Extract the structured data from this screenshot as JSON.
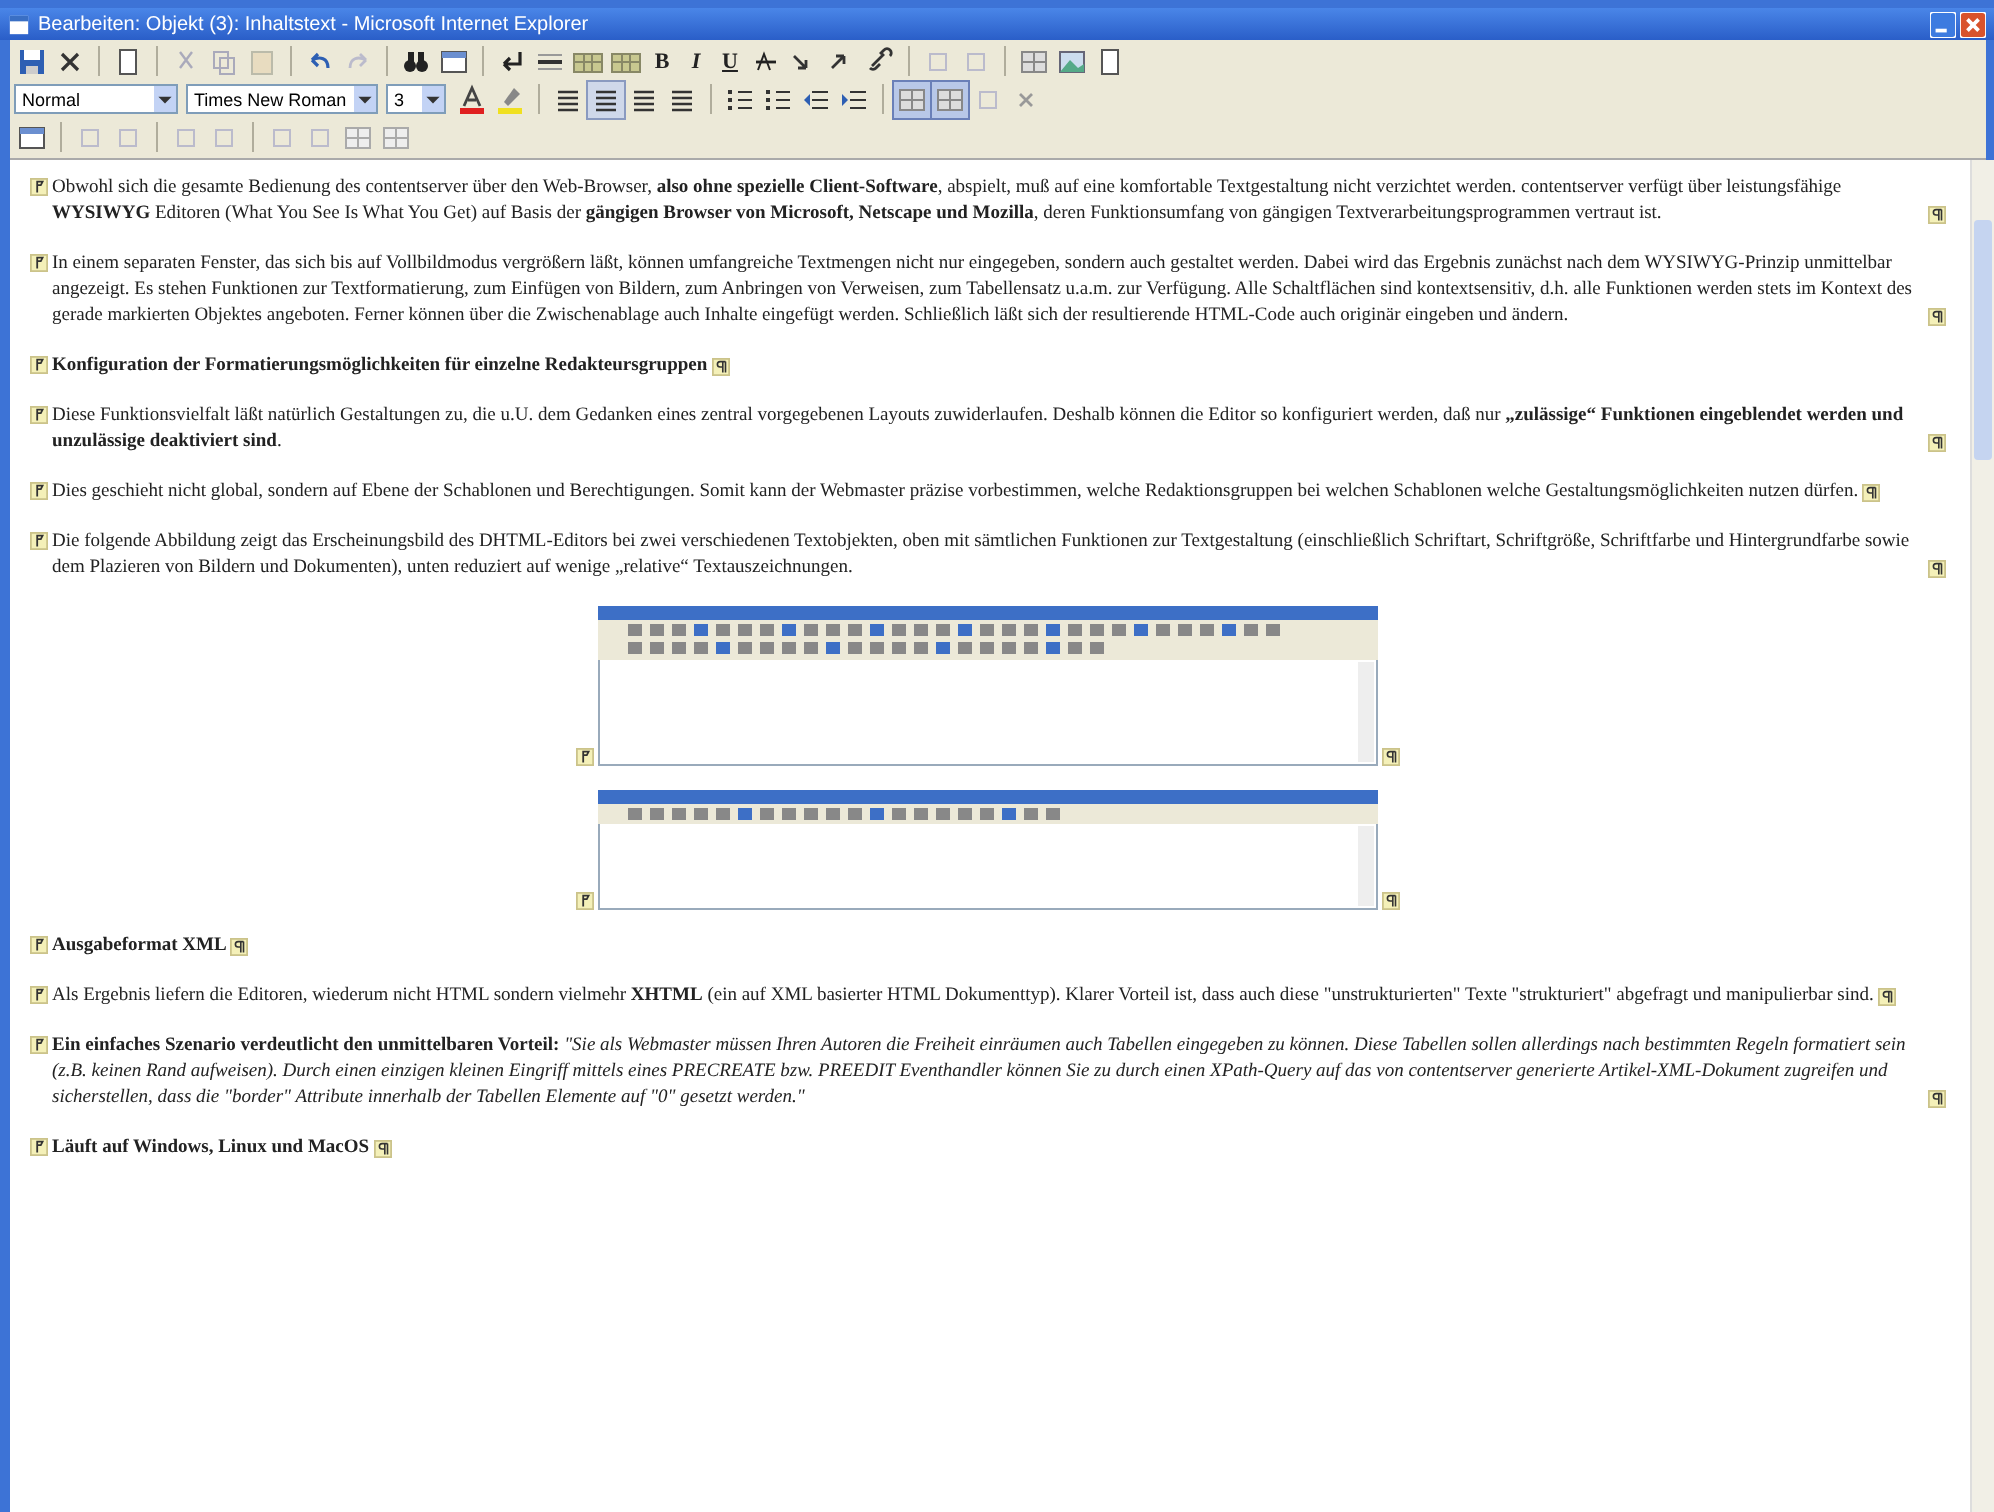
{
  "window": {
    "title": "Bearbeiten: Objekt (3): Inhaltstext - Microsoft Internet Explorer"
  },
  "toolbar": {
    "format_buttons": [
      "B",
      "I",
      "U"
    ],
    "style_select": "Normal",
    "font_select": "Times New Roman",
    "size_select": "3",
    "align_buttons": [
      {
        "selected": false
      },
      {
        "selected": true
      },
      {
        "selected": false
      },
      {
        "selected": false
      }
    ]
  },
  "blocks": [
    {
      "kind": "paragraph",
      "text": "Obwohl sich die gesamte Bedienung des contentserver über den Web-Browser, **also ohne spezielle Client-Software**, abspielt, muß auf eine komfortable Textgestaltung nicht verzichtet werden. contentserver verfügt über leistungsfähige **WYSIWYG** Editoren (What You See Is What You Get) auf Basis der **gängigen Browser von Microsoft, Netscape und Mozilla**, deren Funktionsumfang von gängigen Textverarbeitungsprogrammen vertraut ist."
    },
    {
      "kind": "paragraph",
      "text": "In einem separaten Fenster, das sich bis auf Vollbildmodus vergrößern läßt, können umfangreiche Textmengen nicht nur eingegeben, sondern auch gestaltet werden. Dabei wird das Ergebnis zunächst nach dem WYSIWYG-Prinzip unmittelbar angezeigt. Es stehen Funktionen zur Textformatierung, zum Einfügen von Bildern, zum Anbringen von Verweisen, zum Tabellensatz u.a.m. zur Verfügung. Alle Schaltflächen sind kontextsensitiv, d.h. alle Funktionen werden stets im Kontext des gerade markierten Objektes angeboten. Ferner können über die Zwischenablage auch Inhalte eingefügt werden. Schließlich läßt sich der resultierende HTML-Code auch originär eingeben und ändern."
    },
    {
      "kind": "heading",
      "text": "Konfiguration der Formatierungsmöglichkeiten für einzelne Redakteursgruppen"
    },
    {
      "kind": "paragraph",
      "text": "Diese Funktionsvielfalt läßt natürlich Gestaltungen zu, die u.U. dem Gedanken eines zentral vorgegebenen Layouts zuwiderlaufen. Deshalb können die Editor so konfiguriert werden, daß nur **„zulässige“ Funktionen eingeblendet werden und unzulässige deaktiviert sind**."
    },
    {
      "kind": "paragraph",
      "text": "Dies geschieht nicht global, sondern auf Ebene der Schablonen und Berechtigungen. Somit kann der Webmaster präzise vorbestimmen, welche Redaktionsgruppen bei welchen Schablonen welche Gestaltungsmöglichkeiten nutzen dürfen."
    },
    {
      "kind": "paragraph",
      "text": "Die folgende Abbildung zeigt das Erscheinungsbild des DHTML-Editors bei zwei verschiedenen Textobjekten, oben mit sämtlichen Funktionen zur Textgestaltung (einschließlich Schriftart, Schriftgröße, Schriftfarbe und Hintergrundfarbe sowie dem Plazieren von Bildern und Dokumenten), unten reduziert auf wenige „relative“ Textauszeichnungen."
    },
    {
      "kind": "figure",
      "reduced": false
    },
    {
      "kind": "figure",
      "reduced": true
    },
    {
      "kind": "heading",
      "text": "Ausgabeformat XML"
    },
    {
      "kind": "paragraph",
      "text": "Als Ergebnis liefern die Editoren, wiederum nicht HTML sondern vielmehr **XHTML** (ein auf XML basierter HTML Dokumenttyp). Klarer Vorteil ist, dass auch diese \"unstrukturierten\" Texte \"strukturiert\" abgefragt und manipulierbar sind."
    },
    {
      "kind": "paragraph",
      "text": "**Ein einfaches Szenario verdeutlicht den unmittelbaren Vorteil:** *\"Sie als Webmaster müssen Ihren Autoren die Freiheit einräumen auch Tabellen eingegeben zu können. Diese Tabellen sollen allerdings nach bestimmten Regeln formatiert sein (z.B. keinen Rand aufweisen). Durch einen einzigen kleinen Eingriff mittels eines PRECREATE bzw. PREEDIT Eventhandler können Sie zu durch einen XPath-Query auf das von contentserver generierte Artikel-XML-Dokument zugreifen und sicherstellen, dass die \"border\" Attribute innerhalb der Tabellen Elemente auf \"0\" gesetzt werden.\"*"
    },
    {
      "kind": "heading",
      "text": "Läuft auf Windows, Linux und MacOS"
    }
  ]
}
